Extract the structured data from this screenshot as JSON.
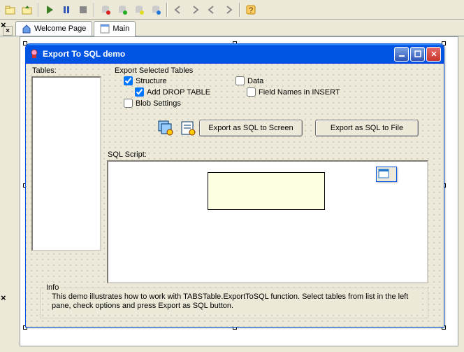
{
  "toolbar": {
    "icons": [
      "folder",
      "folder-up",
      "separator",
      "play",
      "pause",
      "stop",
      "separator",
      "db-red",
      "db-green",
      "db-yellow",
      "db-blue",
      "separator",
      "arrow-left",
      "arrow-right",
      "arrow-left2",
      "arrow-right2",
      "separator",
      "help"
    ]
  },
  "tabs": [
    {
      "label": "Welcome Page",
      "icon": "home",
      "active": false
    },
    {
      "label": "Main",
      "icon": "form",
      "active": true
    }
  ],
  "window": {
    "title": "Export To SQL demo",
    "min": "_",
    "max": "❐",
    "close": "✕"
  },
  "form": {
    "tables_label": "Tables:",
    "group_title": "Export Selected Tables",
    "cb_structure": "Structure",
    "cb_add_drop": "Add DROP TABLE",
    "cb_blob": "Blob Settings",
    "cb_data": "Data",
    "cb_fieldnames": "Field Names in INSERT",
    "btn_screen": "Export as SQL to Screen",
    "btn_file": "Export as SQL to File",
    "sqlscript_label": "SQL Script:",
    "info_title": "Info",
    "info_text": "This demo illustrates  how to work with TABSTable.ExportToSQL function. Select tables from list in the left pane, check options  and  press Export as SQL button."
  }
}
